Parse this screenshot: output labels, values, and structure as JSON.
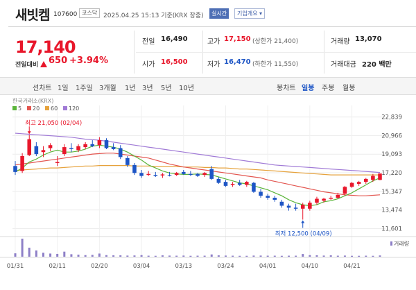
{
  "header": {
    "stock_name": "새빗켐",
    "stock_code": "107600",
    "market": "코스닥",
    "time": "2025.04.25 15:13 기준(KRX 장중)",
    "realtime_button": "실시간",
    "company_info_dropdown": "기업개요 ▾"
  },
  "price": {
    "current": "17,140",
    "change_label": "전일대비",
    "change_icon": "up-triangle-icon",
    "change_value": "650",
    "change_pct": "+3.94%",
    "up_color": "#e8172b",
    "down_color": "#1d55c5"
  },
  "stats": {
    "prev_label": "전일",
    "prev_value": "16,490",
    "open_label": "시가",
    "open_value": "16,500",
    "high_label": "고가",
    "high_value": "17,150",
    "upper_limit": "(상한가 21,400)",
    "low_label": "저가",
    "low_value": "16,470",
    "lower_limit": "(하한가 11,550)",
    "volume_label": "거래량",
    "volume_value": "13,070",
    "amount_label": "거래대금",
    "amount_value": "220 백만"
  },
  "period_tabs": {
    "line_label": "선차트",
    "line_options": [
      "1일",
      "1주일",
      "3개월",
      "1년",
      "3년",
      "5년",
      "10년"
    ],
    "candle_label": "봉차트",
    "candle_options": [
      "일봉",
      "주봉",
      "월봉"
    ],
    "active_candle": "일봉"
  },
  "chart_data": {
    "type": "candlestick",
    "source_label": "한국거래소(KRX)",
    "legend": [
      {
        "name": "5",
        "color": "#5bb53a"
      },
      {
        "name": "20",
        "color": "#e3554f"
      },
      {
        "name": "60",
        "color": "#e6a23c"
      },
      {
        "name": "120",
        "color": "#a07ad6"
      }
    ],
    "ylim": [
      11000,
      23300
    ],
    "y_ticks": [
      "22,839",
      "20,966",
      "19,093",
      "17,220",
      "15,347",
      "13,474",
      "11,601"
    ],
    "y_tick_values": [
      22839,
      20966,
      19093,
      17220,
      15347,
      13474,
      11601
    ],
    "x_ticks": [
      "01/31",
      "02/11",
      "02/20",
      "03/04",
      "03/13",
      "03/24",
      "04/01",
      "04/10",
      "04/21"
    ],
    "x_tick_index": [
      0,
      6,
      12,
      18,
      24,
      30,
      36,
      42,
      48
    ],
    "max_annotation": "최고 21,050 (02/04)",
    "min_annotation": "최저 12,500 (04/09)",
    "max_index": 2,
    "min_index": 41,
    "volume_label": "거래량",
    "candles": [
      {
        "o": 17900,
        "h": 18400,
        "l": 17000,
        "c": 17300
      },
      {
        "o": 17400,
        "h": 19200,
        "l": 17200,
        "c": 18900
      },
      {
        "o": 19000,
        "h": 21050,
        "l": 18900,
        "c": 20600
      },
      {
        "o": 19900,
        "h": 20300,
        "l": 18900,
        "c": 19100
      },
      {
        "o": 19300,
        "h": 19900,
        "l": 18800,
        "c": 19500
      },
      {
        "o": 19700,
        "h": 20200,
        "l": 19400,
        "c": 20000
      },
      {
        "o": 18200,
        "h": 18900,
        "l": 17900,
        "c": 18300
      },
      {
        "o": 19100,
        "h": 20100,
        "l": 18900,
        "c": 19800
      },
      {
        "o": 19700,
        "h": 20200,
        "l": 19300,
        "c": 19600
      },
      {
        "o": 19500,
        "h": 20100,
        "l": 19300,
        "c": 19900
      },
      {
        "o": 19800,
        "h": 20300,
        "l": 19600,
        "c": 20100
      },
      {
        "o": 20100,
        "h": 20500,
        "l": 19800,
        "c": 19900
      },
      {
        "o": 20000,
        "h": 20800,
        "l": 19700,
        "c": 20500
      },
      {
        "o": 20500,
        "h": 20700,
        "l": 19600,
        "c": 19700
      },
      {
        "o": 19800,
        "h": 20200,
        "l": 19500,
        "c": 19600
      },
      {
        "o": 19700,
        "h": 20000,
        "l": 18600,
        "c": 18800
      },
      {
        "o": 18700,
        "h": 18900,
        "l": 17800,
        "c": 18000
      },
      {
        "o": 18000,
        "h": 18200,
        "l": 17000,
        "c": 17200
      },
      {
        "o": 17200,
        "h": 17500,
        "l": 16700,
        "c": 16900
      },
      {
        "o": 17000,
        "h": 17400,
        "l": 16900,
        "c": 17100
      },
      {
        "o": 17000,
        "h": 17300,
        "l": 16800,
        "c": 16900
      },
      {
        "o": 16950,
        "h": 17200,
        "l": 16700,
        "c": 17050
      },
      {
        "o": 17000,
        "h": 17300,
        "l": 16850,
        "c": 16950
      },
      {
        "o": 17000,
        "h": 17300,
        "l": 16900,
        "c": 17200
      },
      {
        "o": 17300,
        "h": 17500,
        "l": 17000,
        "c": 17100
      },
      {
        "o": 17100,
        "h": 17400,
        "l": 16900,
        "c": 17000
      },
      {
        "o": 17100,
        "h": 17200,
        "l": 16800,
        "c": 16900
      },
      {
        "o": 17000,
        "h": 17300,
        "l": 16800,
        "c": 17200
      },
      {
        "o": 17600,
        "h": 17900,
        "l": 16500,
        "c": 16600
      },
      {
        "o": 16600,
        "h": 16800,
        "l": 16100,
        "c": 16200
      },
      {
        "o": 16300,
        "h": 16500,
        "l": 15800,
        "c": 15900
      },
      {
        "o": 16000,
        "h": 16300,
        "l": 15800,
        "c": 16100
      },
      {
        "o": 16200,
        "h": 16500,
        "l": 15900,
        "c": 16000
      },
      {
        "o": 16000,
        "h": 16400,
        "l": 15800,
        "c": 16300
      },
      {
        "o": 16200,
        "h": 16300,
        "l": 15200,
        "c": 15300
      },
      {
        "o": 15300,
        "h": 15600,
        "l": 14700,
        "c": 14900
      },
      {
        "o": 14900,
        "h": 15100,
        "l": 14500,
        "c": 14700
      },
      {
        "o": 14700,
        "h": 14900,
        "l": 14300,
        "c": 14500
      },
      {
        "o": 14300,
        "h": 14500,
        "l": 13700,
        "c": 13900
      },
      {
        "o": 13900,
        "h": 14100,
        "l": 13400,
        "c": 13700
      },
      {
        "o": 13700,
        "h": 14100,
        "l": 13400,
        "c": 13600
      },
      {
        "o": 13600,
        "h": 14200,
        "l": 12500,
        "c": 14000
      },
      {
        "o": 13600,
        "h": 14400,
        "l": 13400,
        "c": 14200
      },
      {
        "o": 14200,
        "h": 14800,
        "l": 14000,
        "c": 14600
      },
      {
        "o": 14400,
        "h": 14700,
        "l": 14200,
        "c": 14600
      },
      {
        "o": 14600,
        "h": 14900,
        "l": 14500,
        "c": 14700
      },
      {
        "o": 14700,
        "h": 15200,
        "l": 14600,
        "c": 15000
      },
      {
        "o": 15100,
        "h": 15900,
        "l": 14900,
        "c": 15800
      },
      {
        "o": 15800,
        "h": 16300,
        "l": 15700,
        "c": 16200
      },
      {
        "o": 16100,
        "h": 16400,
        "l": 15900,
        "c": 16300
      },
      {
        "o": 16300,
        "h": 16700,
        "l": 16100,
        "c": 16600
      },
      {
        "o": 16500,
        "h": 17100,
        "l": 16300,
        "c": 16900
      },
      {
        "o": 16500,
        "h": 17150,
        "l": 16470,
        "c": 17140
      }
    ],
    "ma5": [
      17300,
      17700,
      18300,
      18600,
      19000,
      19300,
      19500,
      19300,
      19300,
      19400,
      19600,
      19900,
      20000,
      19900,
      19800,
      19600,
      19300,
      18900,
      18500,
      18000,
      17700,
      17400,
      17200,
      17100,
      17050,
      17050,
      17100,
      17050,
      17000,
      16800,
      16600,
      16400,
      16200,
      16100,
      15900,
      15700,
      15500,
      15200,
      14900,
      14500,
      14200,
      14000,
      13900,
      14000,
      14300,
      14400,
      14600,
      14900,
      15200,
      15600,
      16000,
      16400,
      16700
    ],
    "ma20": [
      18000,
      18100,
      18200,
      18300,
      18400,
      18500,
      18600,
      18700,
      18800,
      18900,
      19000,
      19100,
      19150,
      19200,
      19200,
      19100,
      19000,
      18900,
      18800,
      18700,
      18500,
      18300,
      18100,
      17950,
      17800,
      17700,
      17600,
      17500,
      17400,
      17300,
      17200,
      17100,
      17000,
      16900,
      16800,
      16700,
      16500,
      16350,
      16200,
      16050,
      15900,
      15750,
      15600,
      15450,
      15300,
      15200,
      15100,
      15000,
      14950,
      14900,
      14900,
      14950,
      15000
    ],
    "ma60": [
      17400,
      17500,
      17550,
      17600,
      17650,
      17700,
      17700,
      17750,
      17800,
      17850,
      17900,
      17900,
      17950,
      17950,
      17950,
      17950,
      17950,
      17900,
      17900,
      17900,
      17850,
      17850,
      17850,
      17850,
      17800,
      17800,
      17800,
      17750,
      17750,
      17700,
      17700,
      17650,
      17600,
      17600,
      17550,
      17500,
      17450,
      17400,
      17350,
      17300,
      17250,
      17200,
      17150,
      17100,
      17050,
      17000,
      17000,
      17000,
      17000,
      17000,
      17000,
      17000,
      17000
    ],
    "ma120": [
      21200,
      21150,
      21100,
      21050,
      21000,
      20950,
      20900,
      20850,
      20800,
      20700,
      20600,
      20550,
      20500,
      20400,
      20300,
      20200,
      20100,
      20000,
      19900,
      19800,
      19700,
      19600,
      19500,
      19400,
      19300,
      19200,
      19100,
      19000,
      18900,
      18800,
      18700,
      18600,
      18500,
      18400,
      18300,
      18200,
      18100,
      18000,
      17950,
      17900,
      17850,
      17800,
      17750,
      17700,
      17650,
      17600,
      17550,
      17500,
      17450,
      17400,
      17350,
      17300,
      17250
    ],
    "volume": [
      30,
      160,
      80,
      55,
      35,
      28,
      25,
      45,
      22,
      18,
      14,
      16,
      28,
      14,
      12,
      12,
      10,
      11,
      14,
      9,
      8,
      12,
      10,
      9,
      10,
      8,
      9,
      9,
      20,
      12,
      10,
      9,
      8,
      8,
      10,
      10,
      9,
      9,
      8,
      9,
      9,
      24,
      14,
      13,
      10,
      12,
      9,
      10,
      8,
      8,
      9,
      8,
      11
    ]
  }
}
